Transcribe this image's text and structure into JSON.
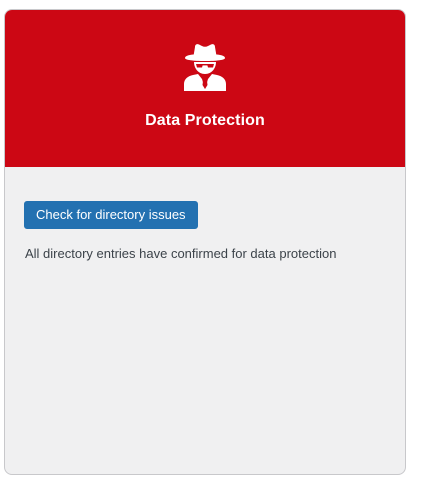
{
  "card": {
    "title": "Data Protection",
    "icon": "user-secret-icon",
    "header_color": "#cc0714",
    "button_label": "Check for directory issues",
    "button_color": "#2271b1",
    "status_message": "All directory entries have confirmed for data protection"
  }
}
